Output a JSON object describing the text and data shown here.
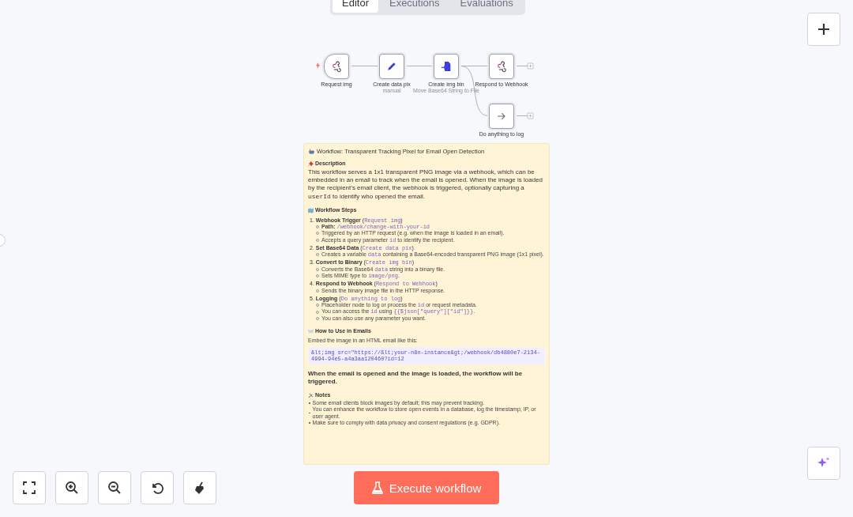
{
  "tabs": [
    {
      "label": "Editor",
      "selected": true
    },
    {
      "label": "Executions",
      "selected": false
    },
    {
      "label": "Evaluations",
      "selected": false
    }
  ],
  "nodes": [
    {
      "label": "Request img",
      "kind": "trigger"
    },
    {
      "label": "Create data pix",
      "subtitle": "manual",
      "kind": "action"
    },
    {
      "label": "Create img bin",
      "subtitle": "Move Base64 String to File",
      "kind": "action"
    },
    {
      "label": "Respond to Webhook",
      "kind": "action"
    },
    {
      "label": "Do anything to log",
      "kind": "action"
    }
  ],
  "note": {
    "title": "Workflow: Transparent Tracking Pixel for Email Open Detection",
    "blocks": [
      {
        "kind": "heading",
        "text": "Description"
      },
      {
        "kind": "lead",
        "parts": [
          {
            "t": "This workflow serves a 1x1 transparent PNG image via a webhook, which can be embedded in an email to track when the email is opened. When the image is loaded by the recipient’s email client, the webhook is triggered, optionally capturing a ",
            "code": false
          },
          {
            "t": "userId",
            "code": true
          },
          {
            "t": " to identify who opened the email.",
            "code": false
          }
        ]
      },
      {
        "kind": "heading",
        "text": "Workflow Steps"
      },
      {
        "kind": "steps",
        "items": [
          {
            "title": [
              {
                "t": "1. **Webhook Trigger** (",
                "code": false
              },
              {
                "t": "Request img",
                "code": true
              },
              {
                "t": ")",
                "code": false
              }
            ],
            "bullets": [
              [
                {
                  "t": "**Path:** ",
                  "code": false
                },
                {
                  "t": "/webhook/change-with-your-id",
                  "code": true
                }
              ],
              [
                {
                  "t": "Triggered by an HTTP request (e.g. when the image is loaded in an email).",
                  "code": false
                }
              ],
              [
                {
                  "t": "Accepts a query parameter ",
                  "code": false
                },
                {
                  "t": "id",
                  "code": true
                },
                {
                  "t": " to identify the recipient.",
                  "code": false
                }
              ]
            ]
          },
          {
            "title": [
              {
                "t": "2. **Set Base64 Data** (",
                "code": false
              },
              {
                "t": "Create data pix",
                "code": true
              },
              {
                "t": ")",
                "code": false
              }
            ],
            "bullets": [
              [
                {
                  "t": "Creates a variable ",
                  "code": false
                },
                {
                  "t": "data",
                  "code": true
                },
                {
                  "t": " containing a Base64-encoded transparent PNG image (1x1 pixel).",
                  "code": false
                }
              ]
            ]
          },
          {
            "title": [
              {
                "t": "3. **Convert to Binary** (",
                "code": false
              },
              {
                "t": "Create img bin",
                "code": true
              },
              {
                "t": ")",
                "code": false
              }
            ],
            "bullets": [
              [
                {
                  "t": "Converts the Base64 ",
                  "code": false
                },
                {
                  "t": "data",
                  "code": true
                },
                {
                  "t": " string into a binary file.",
                  "code": false
                }
              ],
              [
                {
                  "t": "Sets MIME type to ",
                  "code": false
                },
                {
                  "t": "image/png",
                  "code": true
                },
                {
                  "t": ".",
                  "code": false
                }
              ]
            ]
          },
          {
            "title": [
              {
                "t": "4. **Respond to Webhook** (",
                "code": false
              },
              {
                "t": "Respond to Webhook",
                "code": true
              },
              {
                "t": ")",
                "code": false
              }
            ],
            "bullets": [
              [
                {
                  "t": "Sends the binary image file in the HTTP response.",
                  "code": false
                }
              ]
            ]
          },
          {
            "title": [
              {
                "t": "5. **Logging** (",
                "code": false
              },
              {
                "t": "Do anything to log",
                "code": true
              },
              {
                "t": ")",
                "code": false
              }
            ],
            "bullets": [
              [
                {
                  "t": "Placeholder node to log or process the ",
                  "code": false
                },
                {
                  "t": "id",
                  "code": true
                },
                {
                  "t": " or request metadata.",
                  "code": false
                }
              ],
              [
                {
                  "t": "You can access the ",
                  "code": false
                },
                {
                  "t": "id",
                  "code": true
                },
                {
                  "t": " using ",
                  "code": false
                },
                {
                  "t": "{{$json[\"query\"][\"id\"]}}",
                  "code": true
                },
                {
                  "t": ".",
                  "code": false
                }
              ],
              [
                {
                  "t": "You can also use any parameter you want.",
                  "code": false
                }
              ]
            ]
          }
        ]
      },
      {
        "kind": "heading",
        "text": "How to Use in Emails"
      },
      {
        "kind": "small",
        "text": "Embed the image in an HTML email like this:"
      },
      {
        "kind": "code",
        "text": "&lt;img src=\"https://&lt;your-n8n-instance&gt;/webhook/db4880e7-2134-4994-94e5-a4a3aa120460?id=12"
      },
      {
        "kind": "big",
        "text": "When the email is opened and the image is loaded, the workflow will be triggered."
      },
      {
        "kind": "heading",
        "text": "Notes"
      },
      {
        "kind": "bullets",
        "items": [
          "Some email clients block images by default; this may prevent tracking.",
          "You can enhance the workflow to store open events in a database, log the timestamp, IP, or user agent.",
          "Make sure to comply with data privacy and consent regulations (e.g. GDPR)."
        ]
      }
    ]
  },
  "execute_button": {
    "label": "Execute workflow"
  }
}
